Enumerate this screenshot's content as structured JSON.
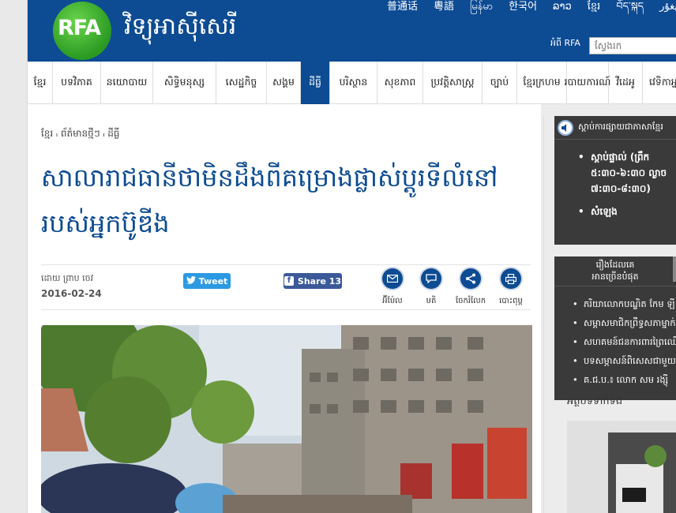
{
  "header": {
    "logo_text": "RFA",
    "site_title": "វិទ្យុអាស៊ីសេរី",
    "languages": [
      "普通话",
      "粵語",
      "မြန်မာ",
      "한국어",
      "ລາວ",
      "ខ្មែរ",
      "བོད་སྐད",
      "ئۇيغۇر"
    ],
    "about": "អំពី RFA",
    "search_placeholder": "ស្វែងរក"
  },
  "nav": {
    "items": [
      "ខ្មែរ",
      "បទវិភាគ",
      "នយោបាយ",
      "សិទ្ធិមនុស្ស",
      "សេដ្ឋកិច្ច",
      "សង្គម",
      "ដីធ្លី",
      "បរិស្ថាន",
      "សុខភាព",
      "ប្រវត្តិសាស្ត្រ",
      "ច្បាប់",
      "ខ្មែរក្រហម",
      "របាយការណ៍",
      "វីដេអូ",
      "វេទិកាអ្នក"
    ]
  },
  "article": {
    "breadcrumb": "ខ្មែរ ៲ ព័ត៌មានថ្មីៗ ៲ ដីធ្លី",
    "title": "សាលារាជធានីថាមិនដឹងពីគម្រោងផ្លាស់ប្ដូរទីលំនៅរបស់អ្នកប៊ូឌីង",
    "author": "ដោយ ព្រាប ចេវ",
    "date": "2016-02-24",
    "tweet_label": "Tweet",
    "share_label": "Share 13",
    "tools": [
      {
        "label": "អ៊ីម៉ែល",
        "icon": "email-icon"
      },
      {
        "label": "មតិ",
        "icon": "comment-icon"
      },
      {
        "label": "ចែករំលែក",
        "icon": "share-icon"
      },
      {
        "label": "បោះពុម្ព",
        "icon": "print-icon"
      }
    ]
  },
  "sidebar": {
    "listen_title": "ស្ដាប់ការផ្សាយជាភាសាខ្មែរ",
    "listen_items": [
      "ស្ដាប់ផ្ទាល់ (ព្រឹក ៥:៣០-៦:៣០ ល្ងាច ៧:៣០-៨:៣០)",
      "សំឡេង"
    ],
    "popular_title_1": "រឿងដែលគេ",
    "popular_title_2": "អានច្រើនបំផុត",
    "popular_items": [
      "ភរិយាលោកបណ្ឌិត កែម ឡី",
      "សម្ដាសមាជិកព្រឹទ្ធសភាម្នាក់",
      "សហគមន៍ជនការពារព្រៃឈើ",
      "បទសម្ភាសន៍ពិសេសជាមួយ",
      "គ.ជ.ប.៖ លោក សម រង្ស៊ី"
    ],
    "box3_label": "អត្ថបទទាក់ទង"
  }
}
